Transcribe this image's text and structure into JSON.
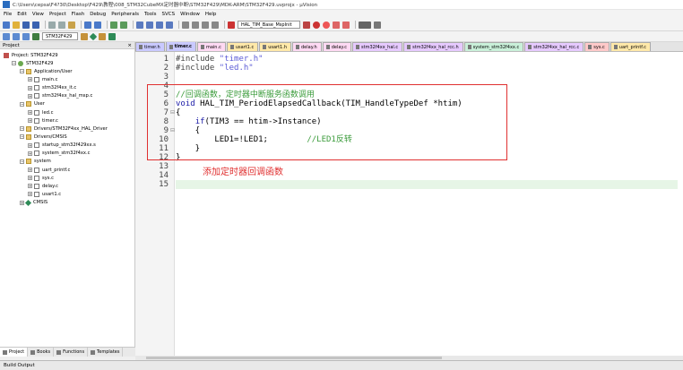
{
  "window": {
    "title": "C:\\Users\\cepsa\\F4?30\\Desktop\\F429\\教程\\008_STM32CubeMX定时器中断\\STM32F429\\MDK-ARM\\STM32F429.uvprojx - µVision"
  },
  "menu": [
    "File",
    "Edit",
    "View",
    "Project",
    "Flash",
    "Debug",
    "Peripherals",
    "Tools",
    "SVCS",
    "Window",
    "Help"
  ],
  "toolbar": {
    "function_combo": "HAL_TIM_Base_MspInit",
    "target_combo": "STM32F429"
  },
  "project_panel": {
    "title": "Project",
    "tree": [
      {
        "label": "Project: STM32F429",
        "level": 0,
        "kind": "proj"
      },
      {
        "label": "STM32F429",
        "level": 1,
        "kind": "target"
      },
      {
        "label": "Application/User",
        "level": 2,
        "kind": "folder"
      },
      {
        "label": "main.c",
        "level": 3,
        "kind": "file"
      },
      {
        "label": "stm32f4xx_it.c",
        "level": 3,
        "kind": "file"
      },
      {
        "label": "stm32f4xx_hal_msp.c",
        "level": 3,
        "kind": "file"
      },
      {
        "label": "User",
        "level": 2,
        "kind": "folder"
      },
      {
        "label": "led.c",
        "level": 3,
        "kind": "file"
      },
      {
        "label": "timer.c",
        "level": 3,
        "kind": "file"
      },
      {
        "label": "Drivers/STM32F4xx_HAL_Driver",
        "level": 2,
        "kind": "folder"
      },
      {
        "label": "Drivers/CMSIS",
        "level": 2,
        "kind": "folder"
      },
      {
        "label": "startup_stm32f429xx.s",
        "level": 3,
        "kind": "file"
      },
      {
        "label": "system_stm32f4xx.c",
        "level": 3,
        "kind": "file"
      },
      {
        "label": "system",
        "level": 2,
        "kind": "folder"
      },
      {
        "label": "uart_printf.c",
        "level": 3,
        "kind": "file"
      },
      {
        "label": "sys.c",
        "level": 3,
        "kind": "file"
      },
      {
        "label": "delay.c",
        "level": 3,
        "kind": "file"
      },
      {
        "label": "usart1.c",
        "level": 3,
        "kind": "file"
      },
      {
        "label": "CMSIS",
        "level": 2,
        "kind": "gem"
      }
    ],
    "bottom_tabs": [
      "Project",
      "Books",
      "Functions",
      "Templates"
    ]
  },
  "file_tabs": [
    {
      "label": "timer.h",
      "color": "#c9c9ff"
    },
    {
      "label": "timer.c",
      "color": "#c9c9ff",
      "active": true
    },
    {
      "label": "main.c",
      "color": "#ffd9f3"
    },
    {
      "label": "usart1.c",
      "color": "#ffe8a8"
    },
    {
      "label": "usart1.h",
      "color": "#ffe8a8"
    },
    {
      "label": "delay.h",
      "color": "#ffd9f3"
    },
    {
      "label": "delay.c",
      "color": "#ffd9f3"
    },
    {
      "label": "stm32f4xx_hal.c",
      "color": "#e6c9ff"
    },
    {
      "label": "stm32f4xx_hal_rcc.h",
      "color": "#e6c9ff"
    },
    {
      "label": "system_stm32f4xx.c",
      "color": "#c9f0d9"
    },
    {
      "label": "stm32f4xx_hal_rcc.c",
      "color": "#e6c9ff"
    },
    {
      "label": "sys.c",
      "color": "#ffc9c9"
    },
    {
      "label": "uart_printf.c",
      "color": "#ffe8a8"
    }
  ],
  "code_lines": [
    {
      "n": "1",
      "segs": [
        {
          "t": "#include ",
          "c": "pre"
        },
        {
          "t": "\"timer.h\"",
          "c": "str"
        }
      ]
    },
    {
      "n": "2",
      "segs": [
        {
          "t": "#include ",
          "c": "pre"
        },
        {
          "t": "\"led.h\"",
          "c": "str"
        }
      ]
    },
    {
      "n": "3",
      "segs": []
    },
    {
      "n": "4",
      "segs": []
    },
    {
      "n": "5",
      "segs": [
        {
          "t": "//回调函数，定时器中断服务函数调用",
          "c": "cmt"
        }
      ]
    },
    {
      "n": "6",
      "segs": [
        {
          "t": "void",
          "c": "kw"
        },
        {
          "t": " HAL_TIM_PeriodElapsedCallback(TIM_HandleTypeDef *htim)",
          "c": ""
        }
      ]
    },
    {
      "n": "7",
      "segs": [
        {
          "t": "{",
          "c": ""
        }
      ]
    },
    {
      "n": "8",
      "segs": [
        {
          "t": "    ",
          "c": ""
        },
        {
          "t": "if",
          "c": "kw"
        },
        {
          "t": "(TIM3 == htim->Instance)",
          "c": ""
        }
      ]
    },
    {
      "n": "9",
      "segs": [
        {
          "t": "    {",
          "c": ""
        }
      ]
    },
    {
      "n": "10",
      "segs": [
        {
          "t": "        LED1=!LED1;        ",
          "c": ""
        },
        {
          "t": "//LED1反转",
          "c": "cmt"
        }
      ]
    },
    {
      "n": "11",
      "segs": [
        {
          "t": "    }",
          "c": ""
        }
      ]
    },
    {
      "n": "12",
      "segs": [
        {
          "t": "}",
          "c": ""
        }
      ]
    },
    {
      "n": "13",
      "segs": []
    },
    {
      "n": "14",
      "segs": []
    },
    {
      "n": "15",
      "segs": [],
      "current": true
    }
  ],
  "annotation": "添加定时器回调函数",
  "build_output": {
    "label": "Build Output"
  }
}
